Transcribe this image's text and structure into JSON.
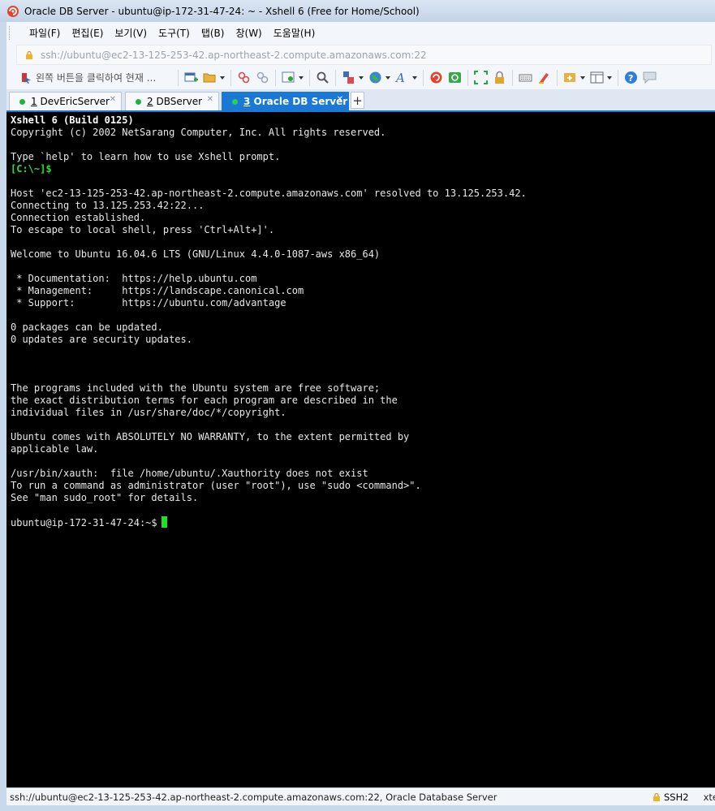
{
  "window": {
    "title": "Oracle DB Server - ubuntu@ip-172-31-47-24: ~ - Xshell 6 (Free for Home/School)",
    "icon": "xshell-app-icon"
  },
  "menubar": {
    "items": [
      "파일(F)",
      "편집(E)",
      "보기(V)",
      "도구(T)",
      "탭(B)",
      "창(W)",
      "도움말(H)"
    ]
  },
  "address": {
    "value": "ssh://ubuntu@ec2-13-125-253-42.ap-northeast-2.compute.amazonaws.com:22"
  },
  "toolbar": {
    "hint": "왼쪽 버튼을 클릭하여 현재 ...",
    "buttons": [
      "new-session-icon",
      "open-folder-icon",
      "disconnect-icon",
      "reconnect-icon",
      "properties-icon",
      "find-icon",
      "transfer-icon",
      "globe-icon",
      "font-icon",
      "xmanager-icon",
      "xftp-icon",
      "fullscreen-icon",
      "lock-icon",
      "keyboard-icon",
      "highlight-icon",
      "add-session-icon",
      "layout-icon",
      "help-icon",
      "chat-icon"
    ]
  },
  "tabs": [
    {
      "number": "1",
      "label": "DevEricServer",
      "active": false
    },
    {
      "number": "2",
      "label": "DBServer",
      "active": false
    },
    {
      "number": "3",
      "label": "Oracle DB Server",
      "active": true
    }
  ],
  "terminal": {
    "lines": [
      {
        "t": "Xshell 6 (Build 0125)",
        "style": "bold"
      },
      {
        "t": "Copyright (c) 2002 NetSarang Computer, Inc. All rights reserved."
      },
      {
        "t": ""
      },
      {
        "t": "Type `help' to learn how to use Xshell prompt."
      },
      {
        "t": "[C:\\~]$",
        "style": "green"
      },
      {
        "t": ""
      },
      {
        "t": "Host 'ec2-13-125-253-42.ap-northeast-2.compute.amazonaws.com' resolved to 13.125.253.42."
      },
      {
        "t": "Connecting to 13.125.253.42:22..."
      },
      {
        "t": "Connection established."
      },
      {
        "t": "To escape to local shell, press 'Ctrl+Alt+]'."
      },
      {
        "t": ""
      },
      {
        "t": "Welcome to Ubuntu 16.04.6 LTS (GNU/Linux 4.4.0-1087-aws x86_64)"
      },
      {
        "t": ""
      },
      {
        "t": " * Documentation:  https://help.ubuntu.com"
      },
      {
        "t": " * Management:     https://landscape.canonical.com"
      },
      {
        "t": " * Support:        https://ubuntu.com/advantage"
      },
      {
        "t": ""
      },
      {
        "t": "0 packages can be updated."
      },
      {
        "t": "0 updates are security updates."
      },
      {
        "t": ""
      },
      {
        "t": ""
      },
      {
        "t": ""
      },
      {
        "t": "The programs included with the Ubuntu system are free software;"
      },
      {
        "t": "the exact distribution terms for each program are described in the"
      },
      {
        "t": "individual files in /usr/share/doc/*/copyright."
      },
      {
        "t": ""
      },
      {
        "t": "Ubuntu comes with ABSOLUTELY NO WARRANTY, to the extent permitted by"
      },
      {
        "t": "applicable law."
      },
      {
        "t": ""
      },
      {
        "t": "/usr/bin/xauth:  file /home/ubuntu/.Xauthority does not exist"
      },
      {
        "t": "To run a command as administrator (user \"root\"), use \"sudo <command>\"."
      },
      {
        "t": "See \"man sudo_root\" for details."
      },
      {
        "t": ""
      }
    ],
    "prompt": "ubuntu@ip-172-31-47-24:~$"
  },
  "status": {
    "text": "ssh://ubuntu@ec2-13-125-253-42.ap-northeast-2.compute.amazonaws.com:22, Oracle Database Server",
    "protocol": "SSH2",
    "terminal_type": "xte"
  },
  "colors": {
    "accent": "#1a78d6",
    "connected": "#1fb33a",
    "cursor": "#1ee21e"
  }
}
